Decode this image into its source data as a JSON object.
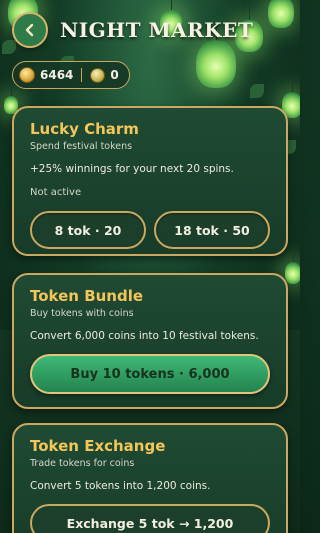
{
  "header": {
    "title": "NIGHT MARKET"
  },
  "currency": {
    "coins": "6464",
    "tokens": "0"
  },
  "cards": {
    "lucky_charm": {
      "title": "Lucky Charm",
      "subtitle": "Spend festival tokens",
      "description": "+25% winnings for your next 20 spins.",
      "status": "Not active",
      "options": [
        "8 tok · 20",
        "18 tok · 50"
      ]
    },
    "token_bundle": {
      "title": "Token Bundle",
      "subtitle": "Buy tokens with coins",
      "description": "Convert 6,000 coins into 10 festival tokens.",
      "button": "Buy 10 tokens · 6,000"
    },
    "token_exchange": {
      "title": "Token Exchange",
      "subtitle": "Trade tokens for coins",
      "description": "Convert 5 tokens into 1,200 coins.",
      "button": "Exchange 5 tok → 1,200"
    }
  }
}
